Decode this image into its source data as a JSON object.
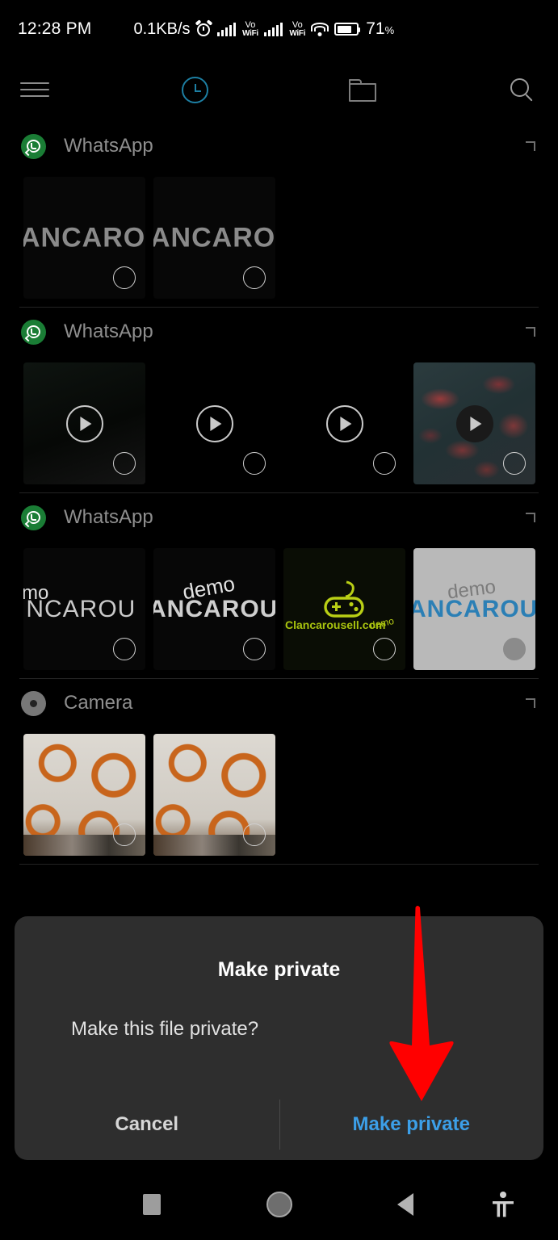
{
  "status_bar": {
    "time": "12:28 PM",
    "network_speed": "0.1KB/s",
    "alarm_icon": "alarm-icon",
    "signal_1_label_top": "Vo",
    "signal_1_label_bottom": "WiFi",
    "signal_2_label_top": "Vo",
    "signal_2_label_bottom": "WiFi",
    "wifi_icon": "wifi-icon",
    "battery_percent": "71",
    "battery_percent_symbol": "%"
  },
  "toolbar": {
    "menu_icon": "hamburger-menu-icon",
    "recent_icon": "clock-icon",
    "folder_icon": "folder-icon",
    "search_icon": "search-icon"
  },
  "groups": [
    {
      "name": "WhatsApp",
      "icon": "whatsapp-icon",
      "chevron": "chevron-right-icon",
      "items": [
        {
          "label": "ANCAROU",
          "art": "art-black",
          "kind": "image",
          "checked": false
        },
        {
          "label": "ANCAROU",
          "art": "art-black",
          "kind": "image",
          "checked": false
        }
      ]
    },
    {
      "name": "WhatsApp",
      "icon": "whatsapp-icon",
      "chevron": "chevron-right-icon",
      "items": [
        {
          "label": "",
          "art": "art-dark",
          "kind": "video",
          "checked": false
        },
        {
          "label": "",
          "art": "art-empty",
          "kind": "video",
          "checked": false
        },
        {
          "label": "",
          "art": "art-empty",
          "kind": "video",
          "checked": false
        },
        {
          "label": "",
          "art": "art-red",
          "kind": "video",
          "checked": false
        }
      ]
    },
    {
      "name": "WhatsApp",
      "icon": "whatsapp-icon",
      "chevron": "chevron-right-icon",
      "items": [
        {
          "label": "INCAROU",
          "sublabel": "mo",
          "art": "art-black",
          "kind": "image",
          "checked": false
        },
        {
          "label": "ANCAROUS",
          "sublabel": "demo",
          "art": "art-black",
          "kind": "image",
          "checked": false
        },
        {
          "label": "Clancarousell.com",
          "sublabel": "demo",
          "art": "art-gamepad",
          "kind": "image",
          "checked": false
        },
        {
          "label": "ANCAROUS",
          "sublabel": "demo",
          "art": "art-light",
          "kind": "image",
          "checked": true
        }
      ]
    },
    {
      "name": "Camera",
      "icon": "camera-icon",
      "chevron": "chevron-right-icon",
      "items": [
        {
          "label": "",
          "art": "art-fabric",
          "kind": "image",
          "checked": false
        },
        {
          "label": "",
          "art": "art-fabric",
          "kind": "image",
          "checked": false
        }
      ]
    }
  ],
  "dialog": {
    "title": "Make private",
    "message": "Make this file private?",
    "cancel_label": "Cancel",
    "confirm_label": "Make private",
    "confirm_color": "#3c9fe8",
    "background_color": "#2e2e2e"
  },
  "annotation": {
    "arrow_icon": "red-down-arrow-annotation",
    "arrow_color": "#ff0000"
  },
  "nav_bar": {
    "recents_icon": "recents-square-icon",
    "home_icon": "home-circle-icon",
    "back_icon": "back-triangle-icon",
    "accessibility_icon": "accessibility-icon"
  }
}
